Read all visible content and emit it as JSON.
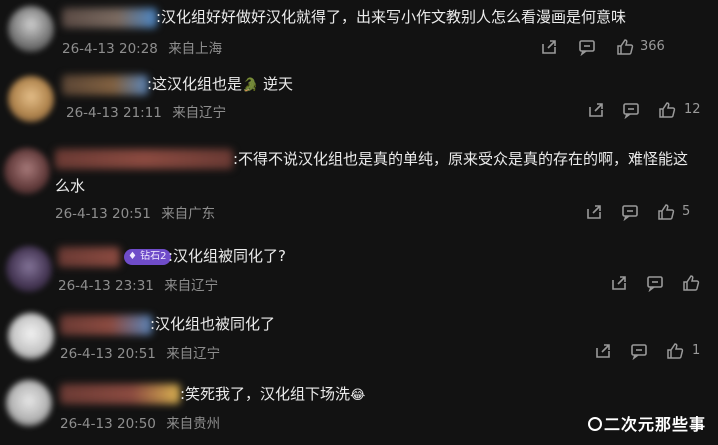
{
  "comments": [
    {
      "text": ":汉化组好好做好汉化就得了，出来写小作文教别人怎么看漫画是何意味",
      "date": "26-4-13 20:28",
      "location": "来自上海",
      "likes": "366"
    },
    {
      "text": ":这汉化组也是",
      "emoji": "🐊",
      "text_after": " 逆天",
      "date": "26-4-13 21:11",
      "location": "来自辽宁",
      "likes": "12"
    },
    {
      "text": ":不得不说汉化组也是真的单纯，原来受众是真的存在的啊，难怪能这",
      "text_line2": "么水",
      "date": "26-4-13 20:51",
      "location": "来自广东",
      "likes": "5"
    },
    {
      "badge": "钻石2",
      "text": ":汉化组被同化了?",
      "date": "26-4-13 23:31",
      "location": "来自辽宁",
      "likes": ""
    },
    {
      "text": ":汉化组也被同化了",
      "date": "26-4-13 20:51",
      "location": "来自辽宁",
      "likes": "1"
    },
    {
      "text": ":笑死我了，汉化组下场洗",
      "emoji": "😂",
      "date": "26-4-13 20:50",
      "location": "来自贵州",
      "likes": ""
    }
  ],
  "watermark": "二次元那些事",
  "icons": [
    "share-icon",
    "comment-icon",
    "like-icon"
  ]
}
